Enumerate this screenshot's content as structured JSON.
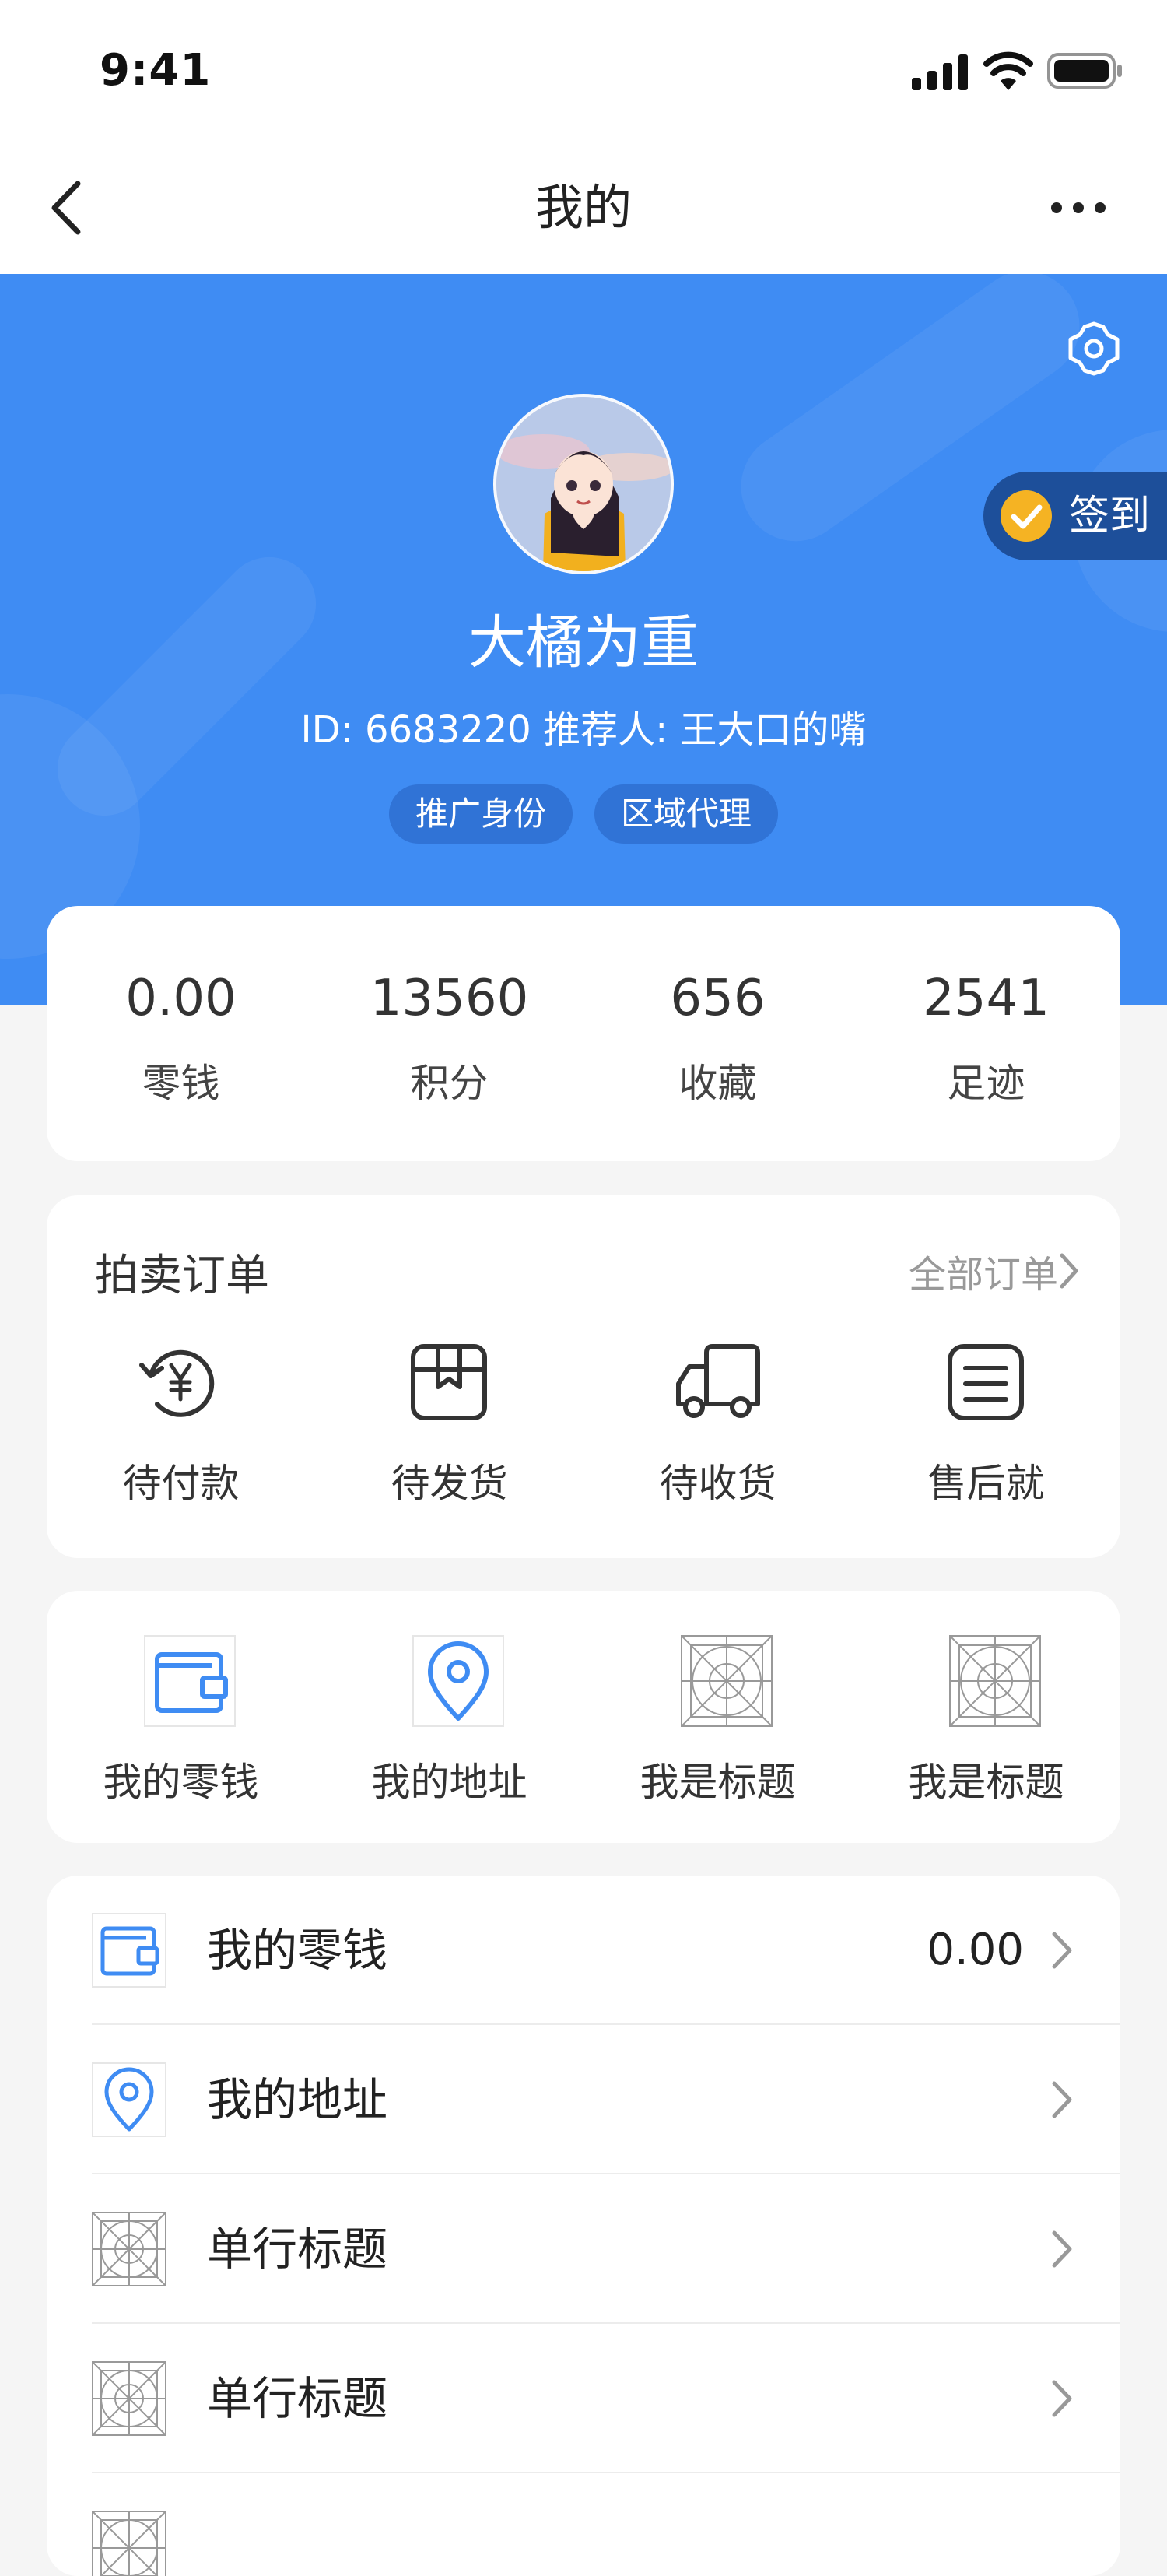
{
  "status_bar": {
    "time": "9:41"
  },
  "nav": {
    "title": "我的"
  },
  "profile": {
    "name": "大橘为重",
    "meta": "ID: 6683220  推荐人: 王大口的嘴",
    "tags": [
      "推广身份",
      "区域代理"
    ],
    "checkin_label": "签到"
  },
  "stats": [
    {
      "value": "0.00",
      "label": "零钱"
    },
    {
      "value": "13560",
      "label": "积分"
    },
    {
      "value": "656",
      "label": "收藏"
    },
    {
      "value": "2541",
      "label": "足迹"
    }
  ],
  "orders": {
    "title": "拍卖订单",
    "all_label": "全部订单",
    "items": [
      {
        "label": "待付款",
        "icon": "pending-payment-icon"
      },
      {
        "label": "待发货",
        "icon": "pending-shipment-icon"
      },
      {
        "label": "待收货",
        "icon": "delivery-truck-icon"
      },
      {
        "label": "售后就",
        "icon": "after-sales-icon"
      }
    ]
  },
  "shortcuts": [
    {
      "label": "我的零钱",
      "icon": "wallet-icon"
    },
    {
      "label": "我的地址",
      "icon": "location-pin-icon"
    },
    {
      "label": "我是标题",
      "icon": "placeholder-icon"
    },
    {
      "label": "我是标题",
      "icon": "placeholder-icon"
    }
  ],
  "menu": [
    {
      "label": "我的零钱",
      "value": "0.00",
      "icon": "wallet-icon"
    },
    {
      "label": "我的地址",
      "value": "",
      "icon": "location-pin-icon"
    },
    {
      "label": "单行标题",
      "value": "",
      "icon": "placeholder-icon"
    },
    {
      "label": "单行标题",
      "value": "",
      "icon": "placeholder-icon"
    },
    {
      "label": "",
      "value": "",
      "icon": "placeholder-icon"
    }
  ],
  "colors": {
    "brand": "#3f8cf3",
    "checkin_bg": "#1d4f9a",
    "checkin_icon": "#f5b323",
    "background": "#f5f5f5"
  }
}
